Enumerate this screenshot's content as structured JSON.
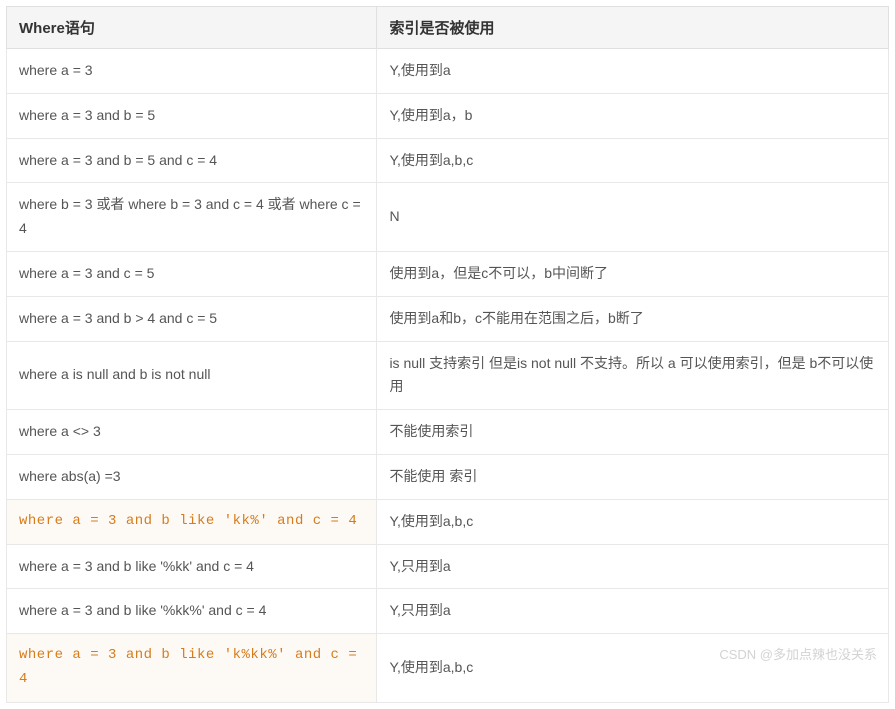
{
  "table": {
    "headers": [
      "Where语句",
      "索引是否被使用"
    ],
    "rows": [
      {
        "where": "where a = 3",
        "result": "Y,使用到a",
        "code": false
      },
      {
        "where": "where a = 3 and b = 5",
        "result": "Y,使用到a，b",
        "code": false
      },
      {
        "where": "where a = 3 and b = 5 and c = 4",
        "result": "Y,使用到a,b,c",
        "code": false
      },
      {
        "where": "where b = 3 或者 where b = 3 and c = 4 或者 where c = 4",
        "result": "N",
        "code": false
      },
      {
        "where": "where a = 3 and c = 5",
        "result": "使用到a，但是c不可以，b中间断了",
        "code": false
      },
      {
        "where": "where a = 3 and b > 4 and c = 5",
        "result": "使用到a和b，c不能用在范围之后，b断了",
        "code": false
      },
      {
        "where": "where a is null and b is not null",
        "result": "is null 支持索引 但是is not null 不支持。所以 a 可以使用索引，但是 b不可以使用",
        "code": false
      },
      {
        "where": "where a <> 3",
        "result": "不能使用索引",
        "code": false
      },
      {
        "where": "where abs(a) =3",
        "result": "不能使用 索引",
        "code": false
      },
      {
        "where": "where a = 3 and b like 'kk%' and c = 4",
        "result": "Y,使用到a,b,c",
        "code": true
      },
      {
        "where": "where a = 3 and b like '%kk' and c = 4",
        "result": "Y,只用到a",
        "code": false
      },
      {
        "where": "where a = 3 and b like '%kk%' and c = 4",
        "result": "Y,只用到a",
        "code": false
      },
      {
        "where": "where a = 3 and b like 'k%kk%' and c = 4",
        "result": "Y,使用到a,b,c",
        "code": true
      }
    ]
  },
  "watermark": "CSDN @多加点辣也没关系"
}
